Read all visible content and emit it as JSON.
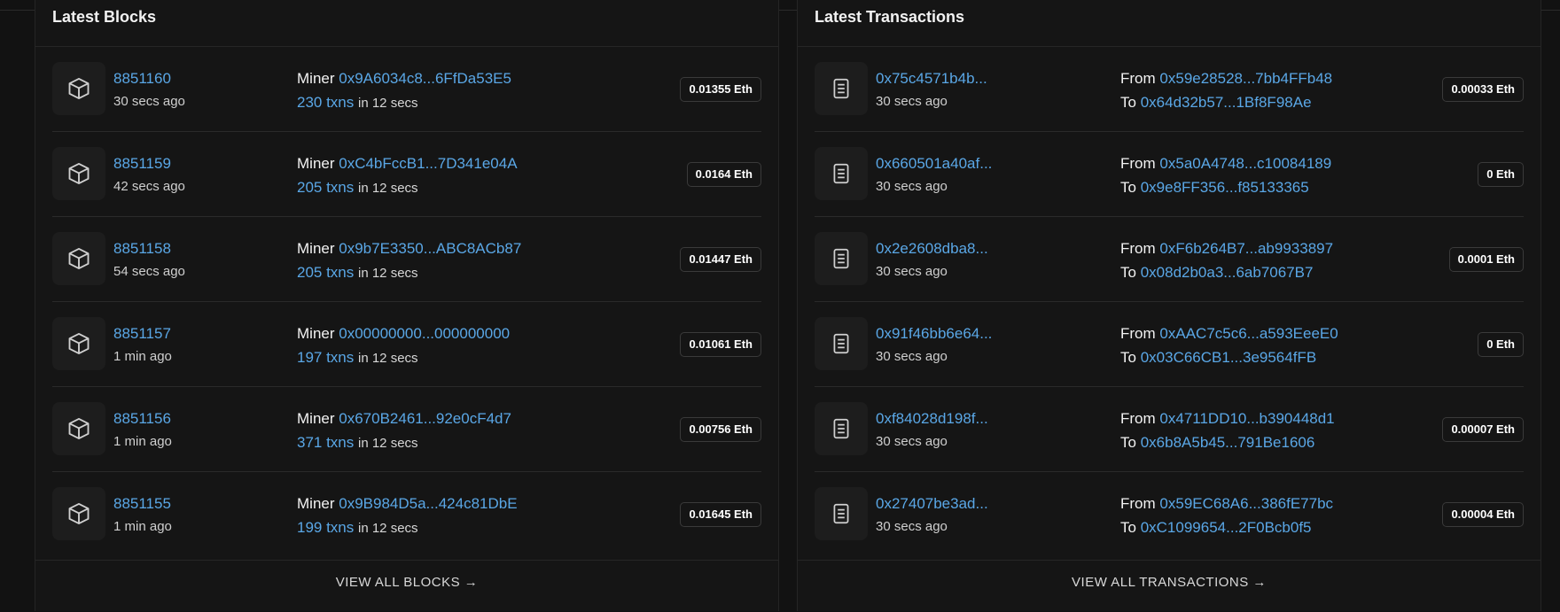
{
  "blocks_panel": {
    "title": "Latest Blocks",
    "view_all_label": "VIEW ALL BLOCKS →",
    "rows": [
      {
        "number": "8851160",
        "ago": "30 secs ago",
        "miner_label": "Miner",
        "miner": "0x9A6034c8...6FfDa53E5",
        "txns": "230 txns",
        "in_time": "in 12 secs",
        "reward": "0.01355 Eth"
      },
      {
        "number": "8851159",
        "ago": "42 secs ago",
        "miner_label": "Miner",
        "miner": "0xC4bFccB1...7D341e04A",
        "txns": "205 txns",
        "in_time": "in 12 secs",
        "reward": "0.0164 Eth"
      },
      {
        "number": "8851158",
        "ago": "54 secs ago",
        "miner_label": "Miner",
        "miner": "0x9b7E3350...ABC8ACb87",
        "txns": "205 txns",
        "in_time": "in 12 secs",
        "reward": "0.01447 Eth"
      },
      {
        "number": "8851157",
        "ago": "1 min ago",
        "miner_label": "Miner",
        "miner": "0x00000000...000000000",
        "txns": "197 txns",
        "in_time": "in 12 secs",
        "reward": "0.01061 Eth"
      },
      {
        "number": "8851156",
        "ago": "1 min ago",
        "miner_label": "Miner",
        "miner": "0x670B2461...92e0cF4d7",
        "txns": "371 txns",
        "in_time": "in 12 secs",
        "reward": "0.00756 Eth"
      },
      {
        "number": "8851155",
        "ago": "1 min ago",
        "miner_label": "Miner",
        "miner": "0x9B984D5a...424c81DbE",
        "txns": "199 txns",
        "in_time": "in 12 secs",
        "reward": "0.01645 Eth"
      }
    ]
  },
  "txns_panel": {
    "title": "Latest Transactions",
    "view_all_label": "VIEW ALL TRANSACTIONS →",
    "rows": [
      {
        "hash": "0x75c4571b4b...",
        "ago": "30 secs ago",
        "from_label": "From",
        "from": "0x59e28528...7bb4FFb48",
        "to_label": "To",
        "to": "0x64d32b57...1Bf8F98Ae",
        "value": "0.00033 Eth"
      },
      {
        "hash": "0x660501a40af...",
        "ago": "30 secs ago",
        "from_label": "From",
        "from": "0x5a0A4748...c10084189",
        "to_label": "To",
        "to": "0x9e8FF356...f85133365",
        "value": "0 Eth"
      },
      {
        "hash": "0x2e2608dba8...",
        "ago": "30 secs ago",
        "from_label": "From",
        "from": "0xF6b264B7...ab9933897",
        "to_label": "To",
        "to": "0x08d2b0a3...6ab7067B7",
        "value": "0.0001 Eth"
      },
      {
        "hash": "0x91f46bb6e64...",
        "ago": "30 secs ago",
        "from_label": "From",
        "from": "0xAAC7c5c6...a593EeeE0",
        "to_label": "To",
        "to": "0x03C66CB1...3e9564fFB",
        "value": "0 Eth"
      },
      {
        "hash": "0xf84028d198f...",
        "ago": "30 secs ago",
        "from_label": "From",
        "from": "0x4711DD10...b390448d1",
        "to_label": "To",
        "to": "0x6b8A5b45...791Be1606",
        "value": "0.00007 Eth"
      },
      {
        "hash": "0x27407be3ad...",
        "ago": "30 secs ago",
        "from_label": "From",
        "from": "0x59EC68A6...386fE77bc",
        "to_label": "To",
        "to": "0xC1099654...2F0Bcb0f5",
        "value": "0.00004 Eth"
      }
    ]
  },
  "icons": {
    "block": "cube-icon",
    "transaction": "document-icon"
  },
  "colors": {
    "background": "#121212",
    "panel": "#151515",
    "link": "#5aa7e6",
    "border": "#2a2a2a"
  }
}
